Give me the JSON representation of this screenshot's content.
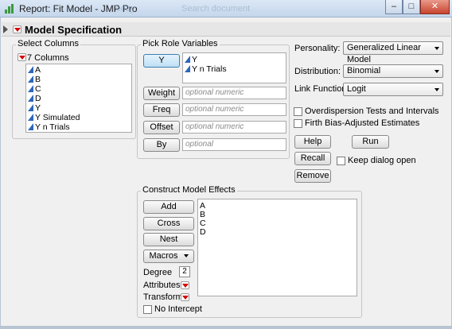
{
  "window": {
    "title": "Report: Fit Model - JMP Pro",
    "bg_tab_text": "Today",
    "bg_search_text": "Search document",
    "min_glyph": "–",
    "max_glyph": "□",
    "close_glyph": "✕"
  },
  "header": {
    "title": "Model Specification"
  },
  "select_columns": {
    "label": "Select Columns",
    "count_label": "7 Columns",
    "columns": [
      "A",
      "B",
      "C",
      "D",
      "Y",
      "Y Simulated",
      "Y n Trials"
    ]
  },
  "pick_roles": {
    "label": "Pick Role Variables",
    "y_button": "Y",
    "y_items": [
      "Y",
      "Y n Trials"
    ],
    "weight_button": "Weight",
    "weight_placeholder": "optional numeric",
    "freq_button": "Freq",
    "freq_placeholder": "optional numeric",
    "offset_button": "Offset",
    "offset_placeholder": "optional numeric",
    "by_button": "By",
    "by_placeholder": "optional"
  },
  "options": {
    "personality_label": "Personality:",
    "personality_value": "Generalized Linear Model",
    "distribution_label": "Distribution:",
    "distribution_value": "Binomial",
    "link_label": "Link Function",
    "link_value": "Logit",
    "overdispersion_label": "Overdispersion Tests and Intervals",
    "overdispersion_checked": false,
    "firth_label": "Firth Bias-Adjusted Estimates",
    "firth_checked": false
  },
  "actions": {
    "help": "Help",
    "run": "Run",
    "recall": "Recall",
    "keep_dialog_label": "Keep dialog open",
    "keep_dialog_checked": false,
    "remove": "Remove"
  },
  "construct": {
    "label": "Construct Model Effects",
    "add": "Add",
    "cross": "Cross",
    "nest": "Nest",
    "macros": "Macros",
    "degree_label": "Degree",
    "degree_value": "2",
    "attributes_label": "Attributes",
    "transform_label": "Transform",
    "no_intercept_label": "No Intercept",
    "no_intercept_checked": false,
    "effects": [
      "A",
      "B",
      "C",
      "D"
    ]
  },
  "colors": {
    "accent_red": "#d40000",
    "column_icon_blue": "#2d66b8",
    "selected_button": "#bfe0f5"
  }
}
